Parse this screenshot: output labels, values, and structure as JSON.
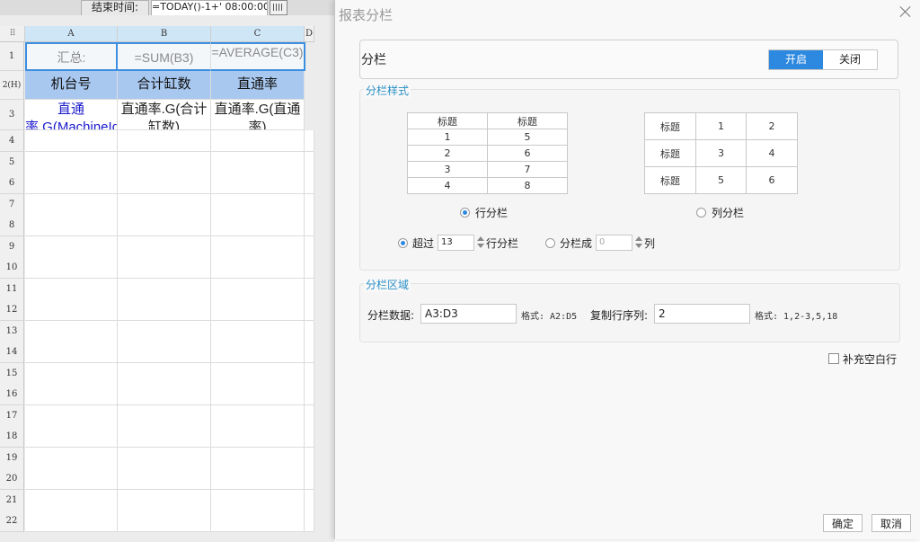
{
  "toolbar": {
    "end_time_label": "结束时间:",
    "end_time_value": "=TODAY()-1+' 08:00:00"
  },
  "sheet": {
    "columns": [
      "A",
      "B",
      "C",
      "D"
    ],
    "rows": [
      "1",
      "2(H)",
      "3",
      "4",
      "5",
      "6",
      "7",
      "8",
      "9",
      "10",
      "11",
      "12",
      "13",
      "14",
      "15",
      "16",
      "17",
      "18",
      "19",
      "20",
      "21",
      "22"
    ],
    "row1": [
      "汇总:",
      "=SUM(B3)",
      "=AVERAGE(C3)"
    ],
    "headers": [
      "机台号",
      "合计缸数",
      "直通率"
    ],
    "row3": [
      "直通率.G(MachineId)",
      "直通率.G(合计缸数)",
      "直通率.G(直通率)"
    ]
  },
  "dialog": {
    "title": "报表分栏",
    "toggle": {
      "label": "分栏",
      "on": "开启",
      "off": "关闭"
    },
    "style_section": {
      "legend": "分栏样式",
      "table1": [
        [
          "标题",
          "标题"
        ],
        [
          "1",
          "5"
        ],
        [
          "2",
          "6"
        ],
        [
          "3",
          "7"
        ],
        [
          "4",
          "8"
        ]
      ],
      "table2": [
        [
          "标题",
          "1",
          "2"
        ],
        [
          "标题",
          "3",
          "4"
        ],
        [
          "标题",
          "5",
          "6"
        ]
      ],
      "row_option": "行分栏",
      "col_option": "列分栏",
      "exceed_label": "超过",
      "exceed_value": "13",
      "exceed_suffix": "行分栏",
      "split_label": "分栏成",
      "split_value": "0",
      "split_suffix": "列"
    },
    "area_section": {
      "legend": "分栏区域",
      "data_label": "分栏数据:",
      "data_value": "A3:D3",
      "data_format": "格式: A2:D5",
      "copy_label": "复制行序列:",
      "copy_value": "2",
      "copy_format": "格式: 1,2-3,5,18"
    },
    "fill_blank": "补充空白行",
    "ok": "确定",
    "cancel": "取消"
  }
}
